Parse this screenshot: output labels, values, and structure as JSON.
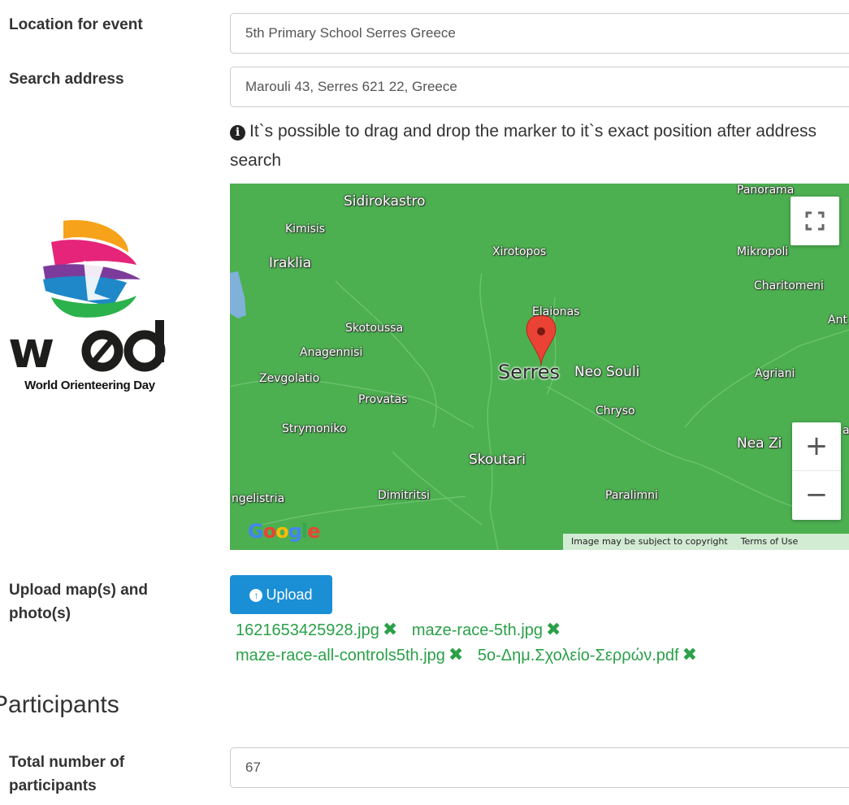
{
  "location": {
    "label": "Location for event",
    "value": "5th Primary School Serres Greece"
  },
  "search": {
    "label": "Search address",
    "value": "Marouli 43, Serres 621 22, Greece"
  },
  "hint": {
    "icon": "info-circle-icon",
    "text": "It`s possible to drag and drop the marker to it`s exact position after address search"
  },
  "logo": {
    "text": "World Orienteering Day"
  },
  "map": {
    "places": [
      "Sidirokastro",
      "Panorama",
      "Kimisis",
      "Xirotopos",
      "Mikropoli",
      "Iraklia",
      "Charitomeni",
      "Elaionas",
      "Skotoussa",
      "Anagennisi",
      "Serres",
      "Neo Souli",
      "Agriani",
      "Zevgolatio",
      "Provatas",
      "Chryso",
      "Strymoniko",
      "Nea Zi",
      "Skoutari",
      "ngelistria",
      "Dimitritsi",
      "Paralimni",
      "Ant",
      "a"
    ],
    "google": "Google",
    "copyright": "Image may be subject to copyright",
    "terms": "Terms of Use",
    "zoom_in": "+",
    "zoom_out": "−"
  },
  "upload": {
    "label": "Upload map(s) and photo(s)",
    "button": "Upload",
    "files": [
      "1621653425928.jpg",
      "maze-race-5th.jpg",
      "maze-race-all-controls5th.jpg",
      "5o-Δημ.Σχολείο-Σερρών.pdf"
    ]
  },
  "participants": {
    "title": "Participants",
    "total_label": "Total number of participants",
    "total_value": "67"
  },
  "colors": {
    "map_green": "#4caf50",
    "button_blue": "#1a8fd6",
    "file_green": "#2aa048"
  }
}
